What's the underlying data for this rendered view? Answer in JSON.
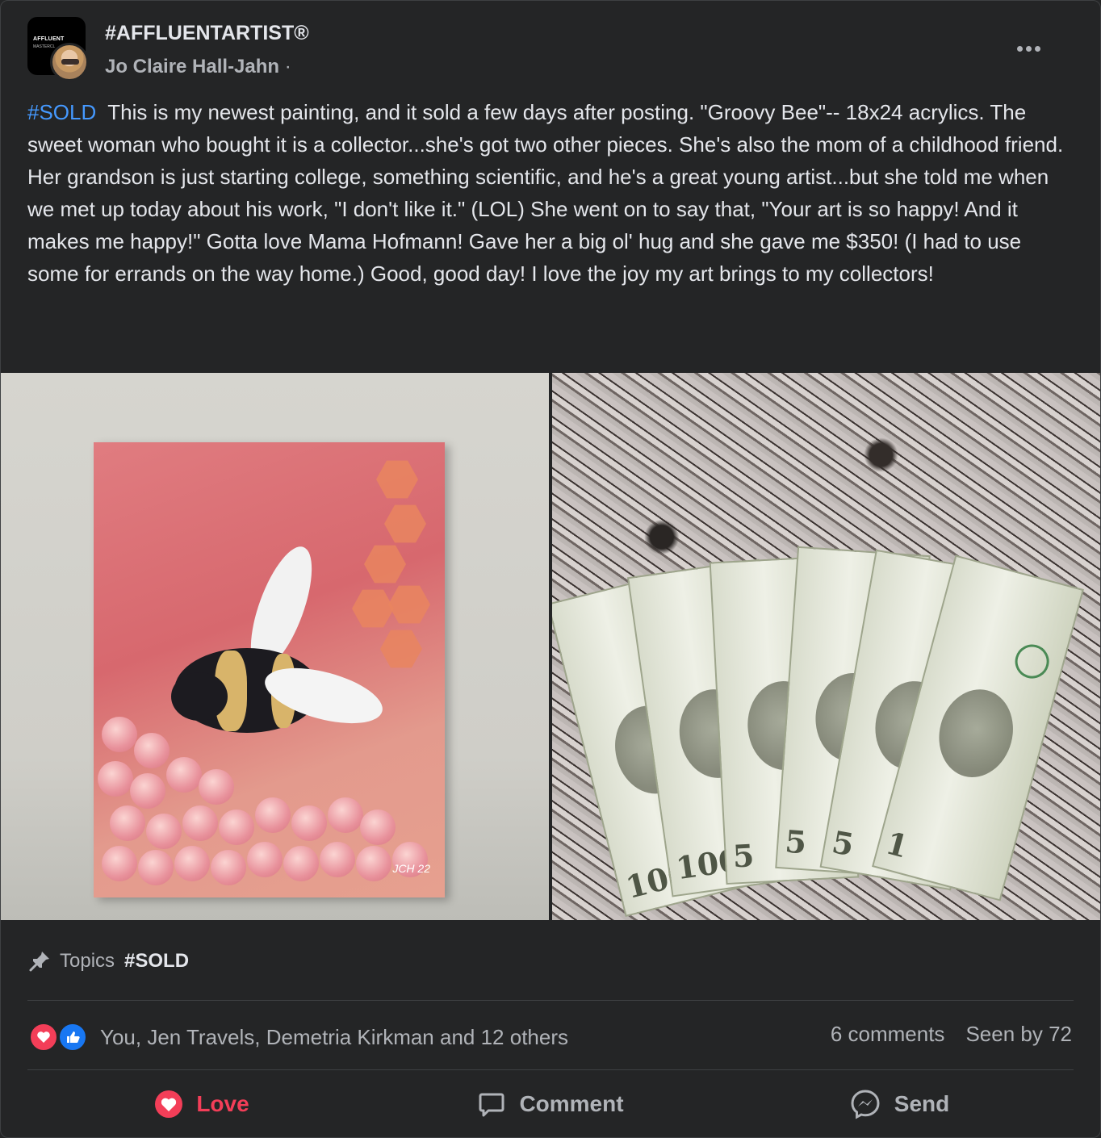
{
  "header": {
    "group_name": "#AFFLUENTARTIST®",
    "group_avatar_text": "AFFLUENT",
    "group_avatar_subtext": "MASTERCL",
    "author": "Jo Claire Hall-Jahn",
    "separator": "·"
  },
  "post": {
    "hashtag": "#SOLD",
    "text": "This is my newest painting, and it sold a few days after posting.  \"Groovy Bee\"-- 18x24 acrylics.  The sweet woman who bought it is a collector...she's got two other pieces.  She's also the mom of a childhood friend.  Her grandson is just starting college, something scientific, and he's a great young artist...but she told me when we met up today about his work, \"I don't like it.\" (LOL)  She went on to say that, \"Your art is so happy!  And it makes me happy!\"  Gotta love Mama Hofmann!  Gave her a big ol' hug and she gave me $350!  (I had to use some for errands on the way home.)  Good, good day! I love the joy my art brings to my collectors!"
  },
  "photos": {
    "painting_signature": "JCH 22"
  },
  "topics": {
    "label": "Topics",
    "tag": "#SOLD",
    "icon": "pin-icon"
  },
  "reactions": {
    "names": "You, Jen Travels, Demetria Kirkman and 12 others",
    "comments": "6 comments",
    "seen_by": "Seen by 72",
    "icons": [
      "heart-icon",
      "like-icon"
    ]
  },
  "actions": {
    "love": "Love",
    "comment": "Comment",
    "send": "Send"
  },
  "colors": {
    "background": "#242526",
    "hashtag": "#4599ff",
    "love": "#f33e58",
    "like": "#1877f2",
    "secondary_text": "#b0b3b8"
  }
}
